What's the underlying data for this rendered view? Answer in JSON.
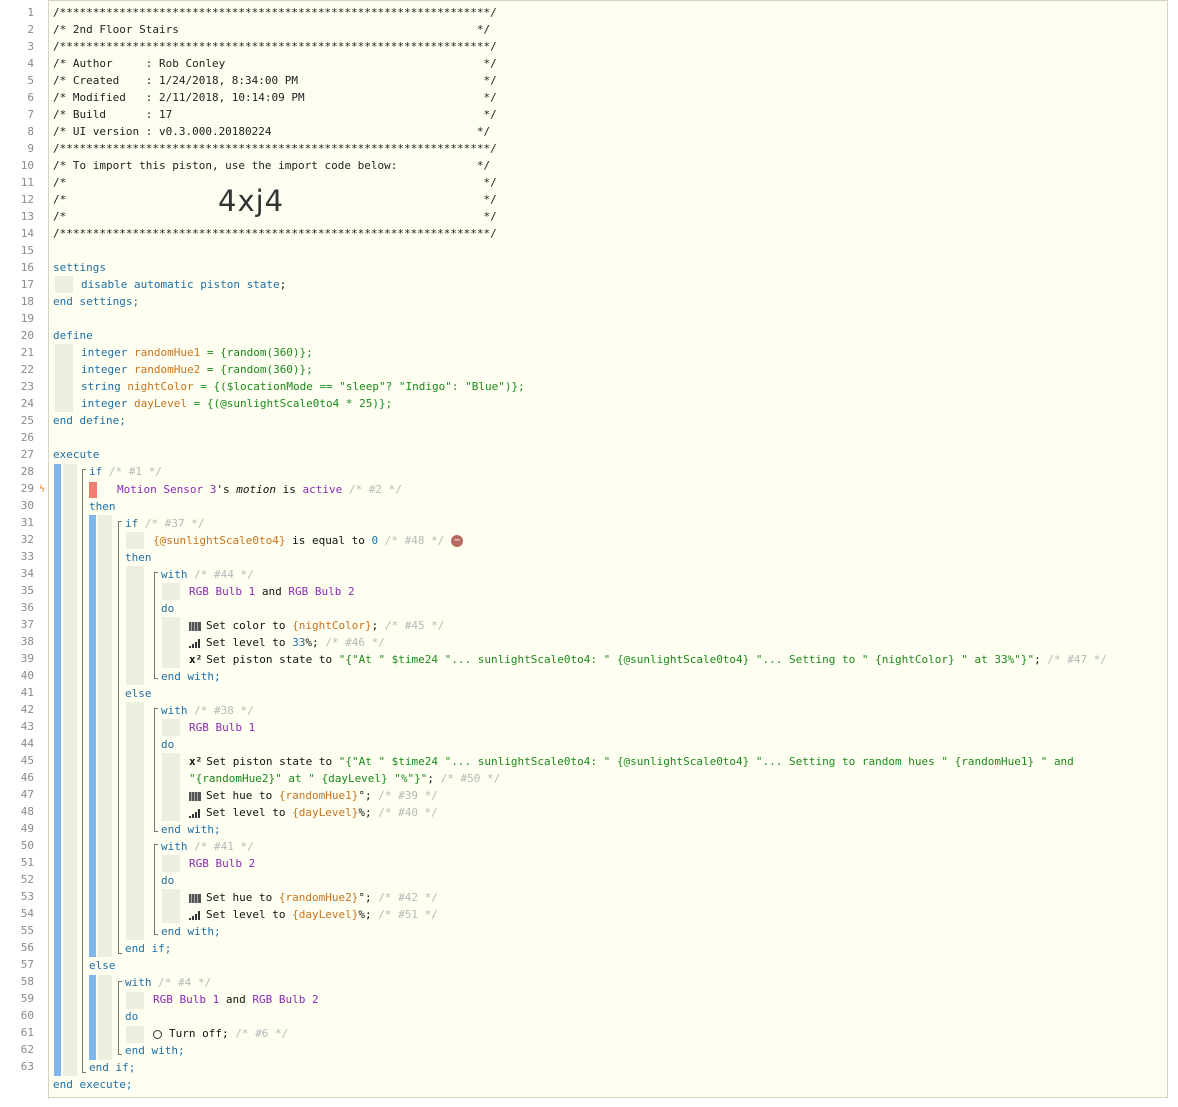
{
  "header": {
    "stars": "/*****************************************************************/",
    "title_line": "/* 2nd Floor Stairs                                             */",
    "author_line": "/* Author     : Rob Conley                                       */",
    "created_line": "/* Created    : 1/24/2018, 8:34:00 PM                            */",
    "modified_line": "/* Modified   : 2/11/2018, 10:14:09 PM                           */",
    "build_line": "/* Build      : 17                                               */",
    "ui_line": "/* UI version : v0.3.000.20180224                               */",
    "import_line": "/* To import this piston, use the import code below:            */",
    "blank_comment": "/*                                                               */",
    "import_code": "4xj4"
  },
  "keywords": {
    "settings": "settings",
    "end_settings": "end settings;",
    "define": "define",
    "end_define": "end define;",
    "execute": "execute",
    "end_execute": "end execute;",
    "if": "if",
    "then": "then",
    "else": "else",
    "end_if": "end if;",
    "with": "with",
    "do": "do",
    "end_with": "end with;"
  },
  "settings_body": {
    "disable": "disable automatic piston state",
    "semi": ";"
  },
  "defines": [
    {
      "type": "integer",
      "name": "randomHue1",
      "expr": " = {random(360)};"
    },
    {
      "type": "integer",
      "name": "randomHue2",
      "expr": " = {random(360)};"
    },
    {
      "type": "string",
      "name": "nightColor",
      "expr": " = {($locationMode == \"sleep\"? \"Indigo\": \"Blue\")};"
    },
    {
      "type": "integer",
      "name": "dayLevel",
      "expr": " = {(@sunlightScale0to4 * 25)};"
    }
  ],
  "execute": {
    "if1_id": "/* #1 */",
    "cond1": {
      "device": "Motion Sensor 3",
      "poss": "'s ",
      "attr": "motion",
      "is": " is ",
      "val": "active",
      "id": " /* #2 */"
    },
    "if2_id": "/* #37 */",
    "cond2": {
      "var": "{@sunlightScale0to4}",
      "op": " is equal to ",
      "val": "0",
      "id": " /* #48 */",
      "minus": "−"
    },
    "with44_id": "/* #44 */",
    "dev_bulb1": "RGB Bulb 1",
    "dev_bulb2": "RGB Bulb 2",
    "and": " and ",
    "t45": {
      "pre": "Set color to ",
      "var": "{nightColor}",
      "post": "; ",
      "id": "/* #45 */"
    },
    "t46": {
      "pre": "Set level to ",
      "num": "33",
      "post": "%; ",
      "id": "/* #46 */"
    },
    "t47": {
      "pre": "Set piston state to ",
      "str": "\"{\"At \" $time24 \"... sunlightScale0to4: \" {@sunlightScale0to4} \"... Setting to \" {nightColor} \" at 33%\"}\"",
      "post": "; ",
      "id": "/* #47 */"
    },
    "with38_id": "/* #38 */",
    "t50": {
      "pre": "Set piston state to ",
      "str1": "\"{\"At \" $time24 \"... sunlightScale0to4: \" {@sunlightScale0to4} \"... Setting to random hues \" {randomHue1} \" and",
      "str2": "\"{randomHue2}\" at \" {dayLevel} \"%\"}\"",
      "post": "; ",
      "id": "/* #50 */"
    },
    "t39": {
      "pre": "Set hue to ",
      "var": "{randomHue1}",
      "post": "°; ",
      "id": "/* #39 */"
    },
    "t40": {
      "pre": "Set level to ",
      "var": "{dayLevel}",
      "post": "%; ",
      "id": "/* #40 */"
    },
    "with41_id": "/* #41 */",
    "t42": {
      "pre": "Set hue to ",
      "var": "{randomHue2}",
      "post": "°; ",
      "id": "/* #42 */"
    },
    "t51": {
      "pre": "Set level to ",
      "var": "{dayLevel}",
      "post": "%; ",
      "id": "/* #51 */"
    },
    "with4_id": "/* #4 */",
    "t6": {
      "pre": "Turn off",
      "post": "; ",
      "id": "/* #6 */"
    },
    "x2": "x²"
  },
  "line_numbers": [
    "1",
    "2",
    "3",
    "4",
    "5",
    "6",
    "7",
    "8",
    "9",
    "10",
    "11",
    "12",
    "13",
    "14",
    "15",
    "16",
    "17",
    "18",
    "19",
    "20",
    "21",
    "22",
    "23",
    "24",
    "25",
    "26",
    "27",
    "28",
    "29",
    "30",
    "31",
    "32",
    "33",
    "34",
    "35",
    "36",
    "37",
    "38",
    "39",
    "40",
    "41",
    "42",
    "43",
    "44",
    "45",
    "46",
    "47",
    "48",
    "49",
    "50",
    "51",
    "52",
    "53",
    "54",
    "55",
    "56",
    "57",
    "58",
    "59",
    "60",
    "61",
    "62",
    "63"
  ]
}
